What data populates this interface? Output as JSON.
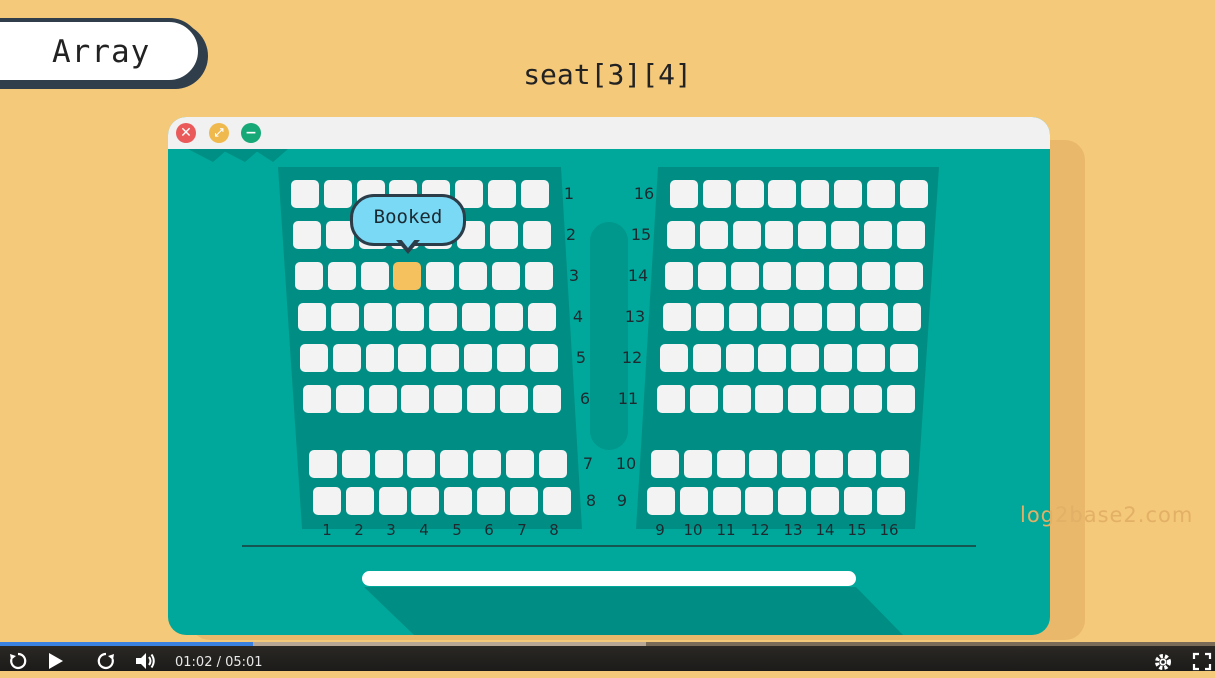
{
  "tag": {
    "label": "Array"
  },
  "title": "seat[3][4]",
  "window": {
    "close_glyph": "✕",
    "fullscreen_glyph": "⤢",
    "minimize_glyph": "−"
  },
  "bubble": {
    "label": "Booked"
  },
  "left_block": {
    "row_labels": [
      "1",
      "2",
      "3",
      "4",
      "5",
      "6",
      "7",
      "8"
    ],
    "col_labels": [
      "1",
      "2",
      "3",
      "4",
      "5",
      "6",
      "7",
      "8"
    ]
  },
  "right_block": {
    "row_labels": [
      "16",
      "15",
      "14",
      "13",
      "12",
      "11",
      "10",
      "9"
    ],
    "col_labels": [
      "9",
      "10",
      "11",
      "12",
      "13",
      "14",
      "15",
      "16"
    ]
  },
  "booked_seat": {
    "row": 3,
    "col": 4
  },
  "watermark": "log2base2.com",
  "player": {
    "replay_icon": "replay-icon",
    "play_icon": "play-icon",
    "forward_icon": "forward-icon",
    "volume_icon": "volume-icon",
    "settings_icon": "gear-icon",
    "fullscreen_icon": "fullscreen-icon",
    "time": "01:02 / 05:01",
    "progress": 0.208,
    "buffered": 0.532
  },
  "colors": {
    "background": "#f5c97a",
    "screen": "#00a89b",
    "seat": "#f3f3f4",
    "booked": "#f5c05e",
    "bubble": "#7ad9f5"
  }
}
